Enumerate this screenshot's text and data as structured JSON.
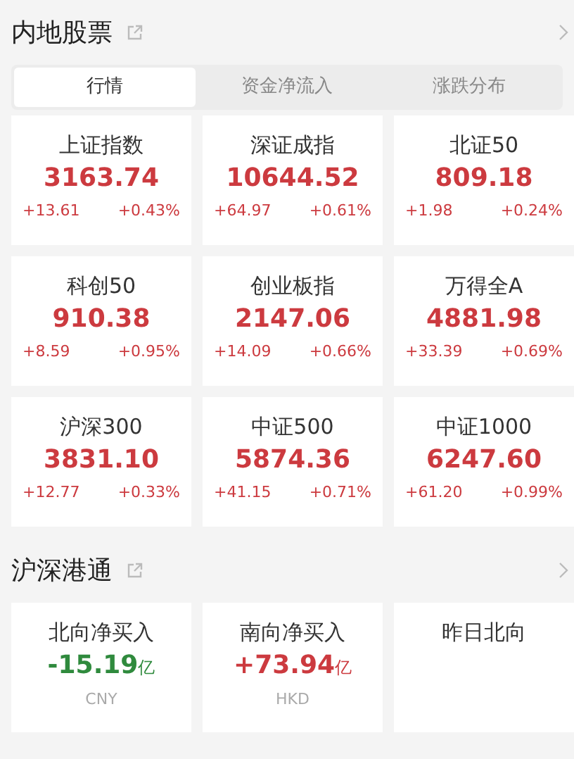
{
  "sections": [
    {
      "title": "内地股票",
      "tabs": [
        {
          "label": "行情",
          "selected": true
        },
        {
          "label": "资金净流入",
          "selected": false
        },
        {
          "label": "涨跌分布",
          "selected": false
        }
      ],
      "cards": [
        {
          "name": "上证指数",
          "value": "3163.74",
          "change": "+13.61",
          "percent": "+0.43%",
          "color": "#cc3a3f"
        },
        {
          "name": "深证成指",
          "value": "10644.52",
          "change": "+64.97",
          "percent": "+0.61%",
          "color": "#cc3a3f"
        },
        {
          "name": "北证50",
          "value": "809.18",
          "change": "+1.98",
          "percent": "+0.24%",
          "color": "#cc3a3f"
        },
        {
          "name": "科创50",
          "value": "910.38",
          "change": "+8.59",
          "percent": "+0.95%",
          "color": "#cc3a3f"
        },
        {
          "name": "创业板指",
          "value": "2147.06",
          "change": "+14.09",
          "percent": "+0.66%",
          "color": "#cc3a3f"
        },
        {
          "name": "万得全A",
          "value": "4881.98",
          "change": "+33.39",
          "percent": "+0.69%",
          "color": "#cc3a3f"
        },
        {
          "name": "沪深300",
          "value": "3831.10",
          "change": "+12.77",
          "percent": "+0.33%",
          "color": "#cc3a3f"
        },
        {
          "name": "中证500",
          "value": "5874.36",
          "change": "+41.15",
          "percent": "+0.71%",
          "color": "#cc3a3f"
        },
        {
          "name": "中证1000",
          "value": "6247.60",
          "change": "+61.20",
          "percent": "+0.99%",
          "color": "#cc3a3f"
        }
      ]
    },
    {
      "title": "沪深港通",
      "cards": [
        {
          "name": "北向净买入",
          "value": "-15.19",
          "unit": "亿",
          "currency": "CNY",
          "color": "#2f8a3d"
        },
        {
          "name": "南向净买入",
          "value": "+73.94",
          "unit": "亿",
          "currency": "HKD",
          "color": "#cc3a3f"
        },
        {
          "name": "昨日北向"
        }
      ]
    }
  ]
}
